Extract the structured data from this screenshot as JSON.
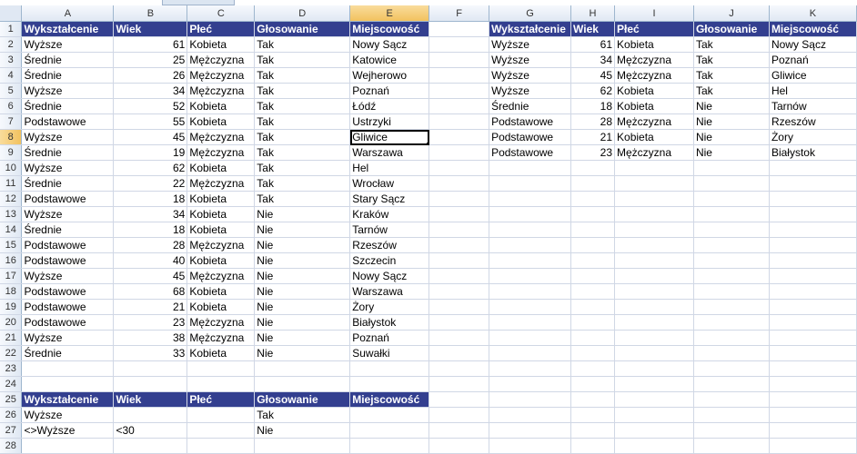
{
  "columns": [
    "A",
    "B",
    "C",
    "D",
    "E",
    "F",
    "G",
    "H",
    "I",
    "J",
    "K"
  ],
  "selected_column": "E",
  "selected_row": 8,
  "active_cell": "E8",
  "rows": [
    {
      "n": 1,
      "c": [
        "Wykształcenie",
        "Wiek",
        "Płeć",
        "Głosowanie",
        "Miejscowość",
        "",
        "Wykształcenie",
        "Wiek",
        "Płeć",
        "Głosowanie",
        "Miejscowość"
      ]
    },
    {
      "n": 2,
      "c": [
        "Wyższe",
        "61",
        "Kobieta",
        "Tak",
        "Nowy Sącz",
        "",
        "Wyższe",
        "61",
        "Kobieta",
        "Tak",
        "Nowy Sącz"
      ]
    },
    {
      "n": 3,
      "c": [
        "Średnie",
        "25",
        "Mężczyzna",
        "Tak",
        "Katowice",
        "",
        "Wyższe",
        "34",
        "Mężczyzna",
        "Tak",
        "Poznań"
      ]
    },
    {
      "n": 4,
      "c": [
        "Średnie",
        "26",
        "Mężczyzna",
        "Tak",
        "Wejherowo",
        "",
        "Wyższe",
        "45",
        "Mężczyzna",
        "Tak",
        "Gliwice"
      ]
    },
    {
      "n": 5,
      "c": [
        "Wyższe",
        "34",
        "Mężczyzna",
        "Tak",
        "Poznań",
        "",
        "Wyższe",
        "62",
        "Kobieta",
        "Tak",
        "Hel"
      ]
    },
    {
      "n": 6,
      "c": [
        "Średnie",
        "52",
        "Kobieta",
        "Tak",
        "Łódź",
        "",
        "Średnie",
        "18",
        "Kobieta",
        "Nie",
        "Tarnów"
      ]
    },
    {
      "n": 7,
      "c": [
        "Podstawowe",
        "55",
        "Kobieta",
        "Tak",
        "Ustrzyki",
        "",
        "Podstawowe",
        "28",
        "Mężczyzna",
        "Nie",
        "Rzeszów"
      ]
    },
    {
      "n": 8,
      "c": [
        "Wyższe",
        "45",
        "Mężczyzna",
        "Tak",
        "Gliwice",
        "",
        "Podstawowe",
        "21",
        "Kobieta",
        "Nie",
        "Żory"
      ]
    },
    {
      "n": 9,
      "c": [
        "Średnie",
        "19",
        "Mężczyzna",
        "Tak",
        "Warszawa",
        "",
        "Podstawowe",
        "23",
        "Mężczyzna",
        "Nie",
        "Białystok"
      ]
    },
    {
      "n": 10,
      "c": [
        "Wyższe",
        "62",
        "Kobieta",
        "Tak",
        "Hel",
        "",
        "",
        "",
        "",
        "",
        ""
      ]
    },
    {
      "n": 11,
      "c": [
        "Średnie",
        "22",
        "Mężczyzna",
        "Tak",
        "Wrocław",
        "",
        "",
        "",
        "",
        "",
        ""
      ]
    },
    {
      "n": 12,
      "c": [
        "Podstawowe",
        "18",
        "Kobieta",
        "Tak",
        "Stary Sącz",
        "",
        "",
        "",
        "",
        "",
        ""
      ]
    },
    {
      "n": 13,
      "c": [
        "Wyższe",
        "34",
        "Kobieta",
        "Nie",
        "Kraków",
        "",
        "",
        "",
        "",
        "",
        ""
      ]
    },
    {
      "n": 14,
      "c": [
        "Średnie",
        "18",
        "Kobieta",
        "Nie",
        "Tarnów",
        "",
        "",
        "",
        "",
        "",
        ""
      ]
    },
    {
      "n": 15,
      "c": [
        "Podstawowe",
        "28",
        "Mężczyzna",
        "Nie",
        "Rzeszów",
        "",
        "",
        "",
        "",
        "",
        ""
      ]
    },
    {
      "n": 16,
      "c": [
        "Podstawowe",
        "40",
        "Kobieta",
        "Nie",
        "Szczecin",
        "",
        "",
        "",
        "",
        "",
        ""
      ]
    },
    {
      "n": 17,
      "c": [
        "Wyższe",
        "45",
        "Mężczyzna",
        "Nie",
        "Nowy Sącz",
        "",
        "",
        "",
        "",
        "",
        ""
      ]
    },
    {
      "n": 18,
      "c": [
        "Podstawowe",
        "68",
        "Kobieta",
        "Nie",
        "Warszawa",
        "",
        "",
        "",
        "",
        "",
        ""
      ]
    },
    {
      "n": 19,
      "c": [
        "Podstawowe",
        "21",
        "Kobieta",
        "Nie",
        "Żory",
        "",
        "",
        "",
        "",
        "",
        ""
      ]
    },
    {
      "n": 20,
      "c": [
        "Podstawowe",
        "23",
        "Mężczyzna",
        "Nie",
        "Białystok",
        "",
        "",
        "",
        "",
        "",
        ""
      ]
    },
    {
      "n": 21,
      "c": [
        "Wyższe",
        "38",
        "Mężczyzna",
        "Nie",
        "Poznań",
        "",
        "",
        "",
        "",
        "",
        ""
      ]
    },
    {
      "n": 22,
      "c": [
        "Średnie",
        "33",
        "Kobieta",
        "Nie",
        "Suwałki",
        "",
        "",
        "",
        "",
        "",
        ""
      ]
    },
    {
      "n": 23,
      "c": [
        "",
        "",
        "",
        "",
        "",
        "",
        "",
        "",
        "",
        "",
        ""
      ]
    },
    {
      "n": 24,
      "c": [
        "",
        "",
        "",
        "",
        "",
        "",
        "",
        "",
        "",
        "",
        ""
      ]
    },
    {
      "n": 25,
      "c": [
        "Wykształcenie",
        "Wiek",
        "Płeć",
        "Głosowanie",
        "Miejscowość",
        "",
        "",
        "",
        "",
        "",
        ""
      ]
    },
    {
      "n": 26,
      "c": [
        "Wyższe",
        "",
        "",
        "Tak",
        "",
        "",
        "",
        "",
        "",
        "",
        ""
      ]
    },
    {
      "n": 27,
      "c": [
        "<>Wyższe",
        "<30",
        "",
        "Nie",
        "",
        "",
        "",
        "",
        "",
        "",
        ""
      ]
    },
    {
      "n": 28,
      "c": [
        "",
        "",
        "",
        "",
        "",
        "",
        "",
        "",
        "",
        "",
        ""
      ]
    }
  ]
}
